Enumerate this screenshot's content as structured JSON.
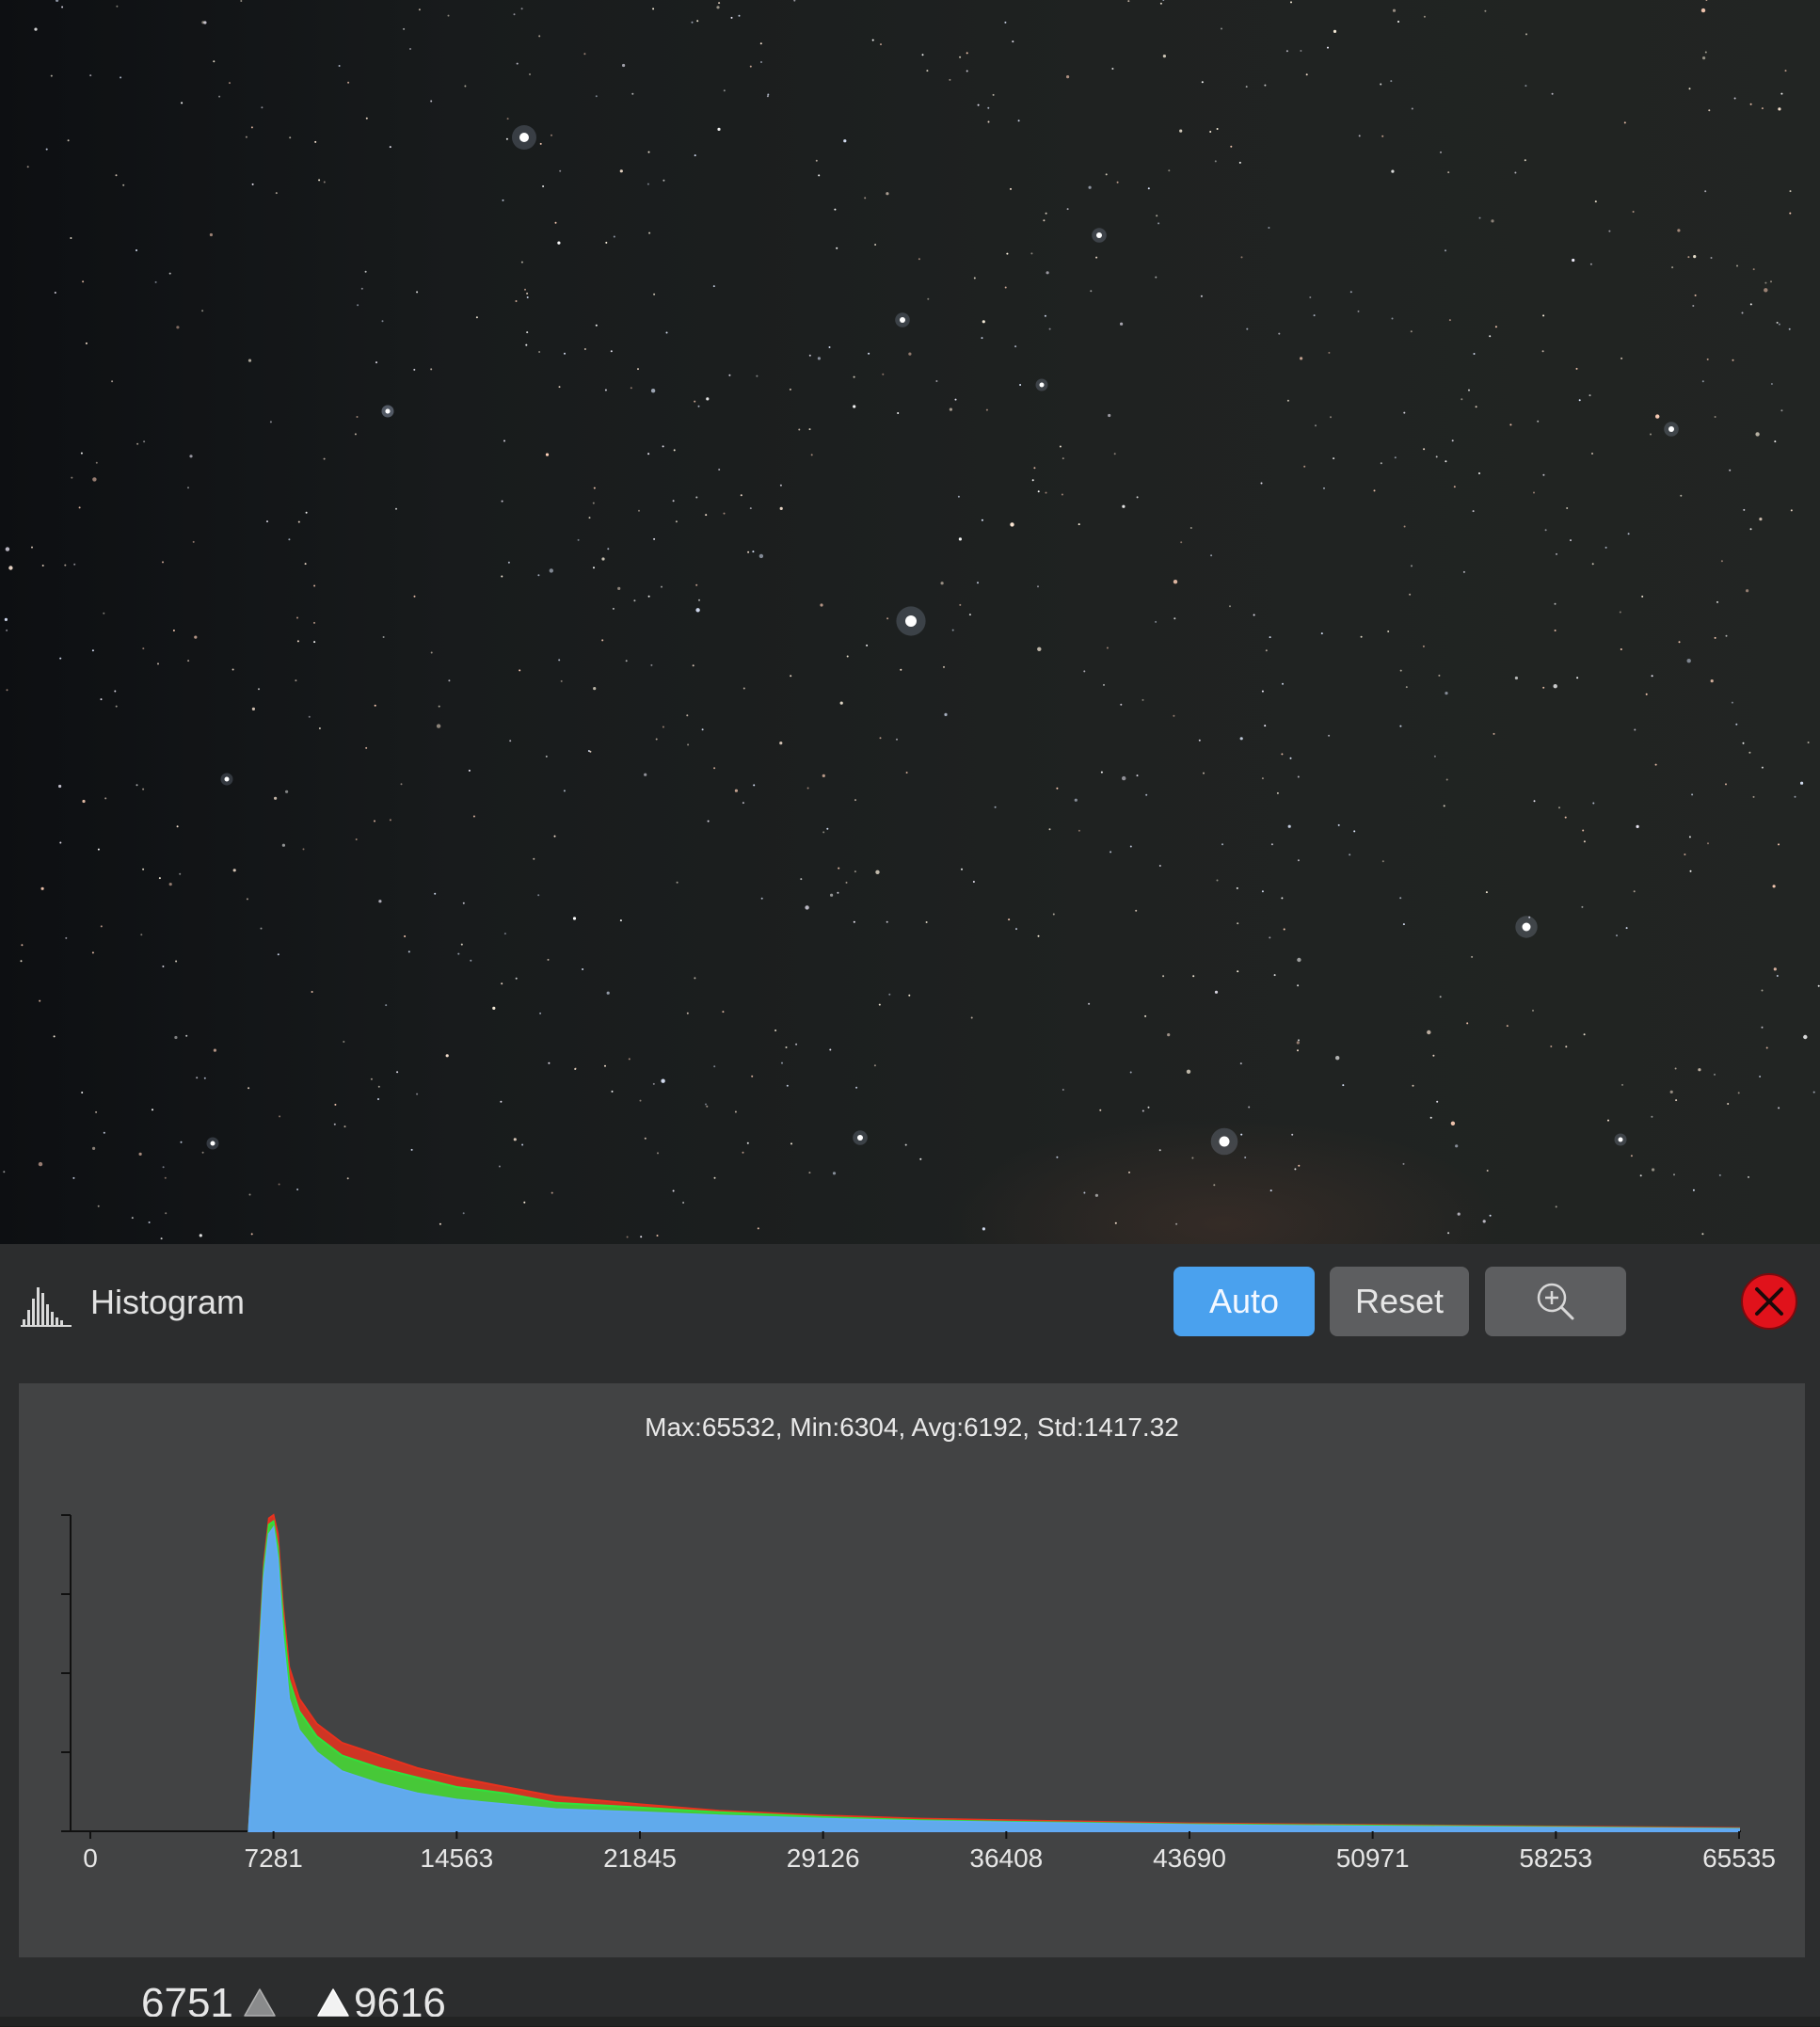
{
  "panel": {
    "title": "Histogram",
    "title_icon": "histogram-icon",
    "buttons": {
      "auto": "Auto",
      "reset": "Reset",
      "zoom_icon": "zoom-in-icon",
      "close_icon": "close-icon"
    },
    "colors": {
      "auto_button": "#4aa1ee",
      "close_button": "#e0121b",
      "red_channel": "#e8321e",
      "green_channel": "#2fe23c",
      "blue_channel": "#62a9f5"
    }
  },
  "levels": {
    "low": "6751",
    "high": "9616"
  },
  "chart_data": {
    "type": "area",
    "title": "Max:65532, Min:6304, Avg:6192, Std:1417.32",
    "xlabel": "",
    "ylabel": "",
    "xlim": [
      0,
      65535
    ],
    "ylim": [
      0,
      1
    ],
    "grid": false,
    "x_ticks": [
      "0",
      "7281",
      "14563",
      "21845",
      "29126",
      "36408",
      "43690",
      "50971",
      "58253",
      "65535"
    ],
    "x": [
      6300,
      6600,
      6900,
      7100,
      7281,
      7450,
      7650,
      7900,
      8300,
      9000,
      10000,
      11500,
      13000,
      14563,
      16500,
      18500,
      21845,
      25000,
      29126,
      33000,
      36408,
      43690,
      50971,
      58253,
      65535
    ],
    "series": [
      {
        "values": [
          0.0,
          0.42,
          0.85,
          0.99,
          1.0,
          0.94,
          0.72,
          0.52,
          0.42,
          0.34,
          0.28,
          0.24,
          0.2,
          0.17,
          0.14,
          0.11,
          0.085,
          0.065,
          0.05,
          0.04,
          0.035,
          0.025,
          0.02,
          0.015,
          0.01
        ]
      },
      {
        "values": [
          0.0,
          0.4,
          0.83,
          0.97,
          0.98,
          0.9,
          0.68,
          0.48,
          0.38,
          0.3,
          0.24,
          0.2,
          0.17,
          0.14,
          0.12,
          0.09,
          0.075,
          0.06,
          0.045,
          0.035,
          0.03,
          0.022,
          0.018,
          0.013,
          0.008
        ]
      },
      {
        "values": [
          0.0,
          0.38,
          0.8,
          0.94,
          0.96,
          0.86,
          0.62,
          0.42,
          0.32,
          0.25,
          0.19,
          0.15,
          0.12,
          0.1,
          0.085,
          0.07,
          0.06,
          0.05,
          0.04,
          0.032,
          0.028,
          0.02,
          0.015,
          0.011,
          0.007
        ]
      }
    ]
  }
}
